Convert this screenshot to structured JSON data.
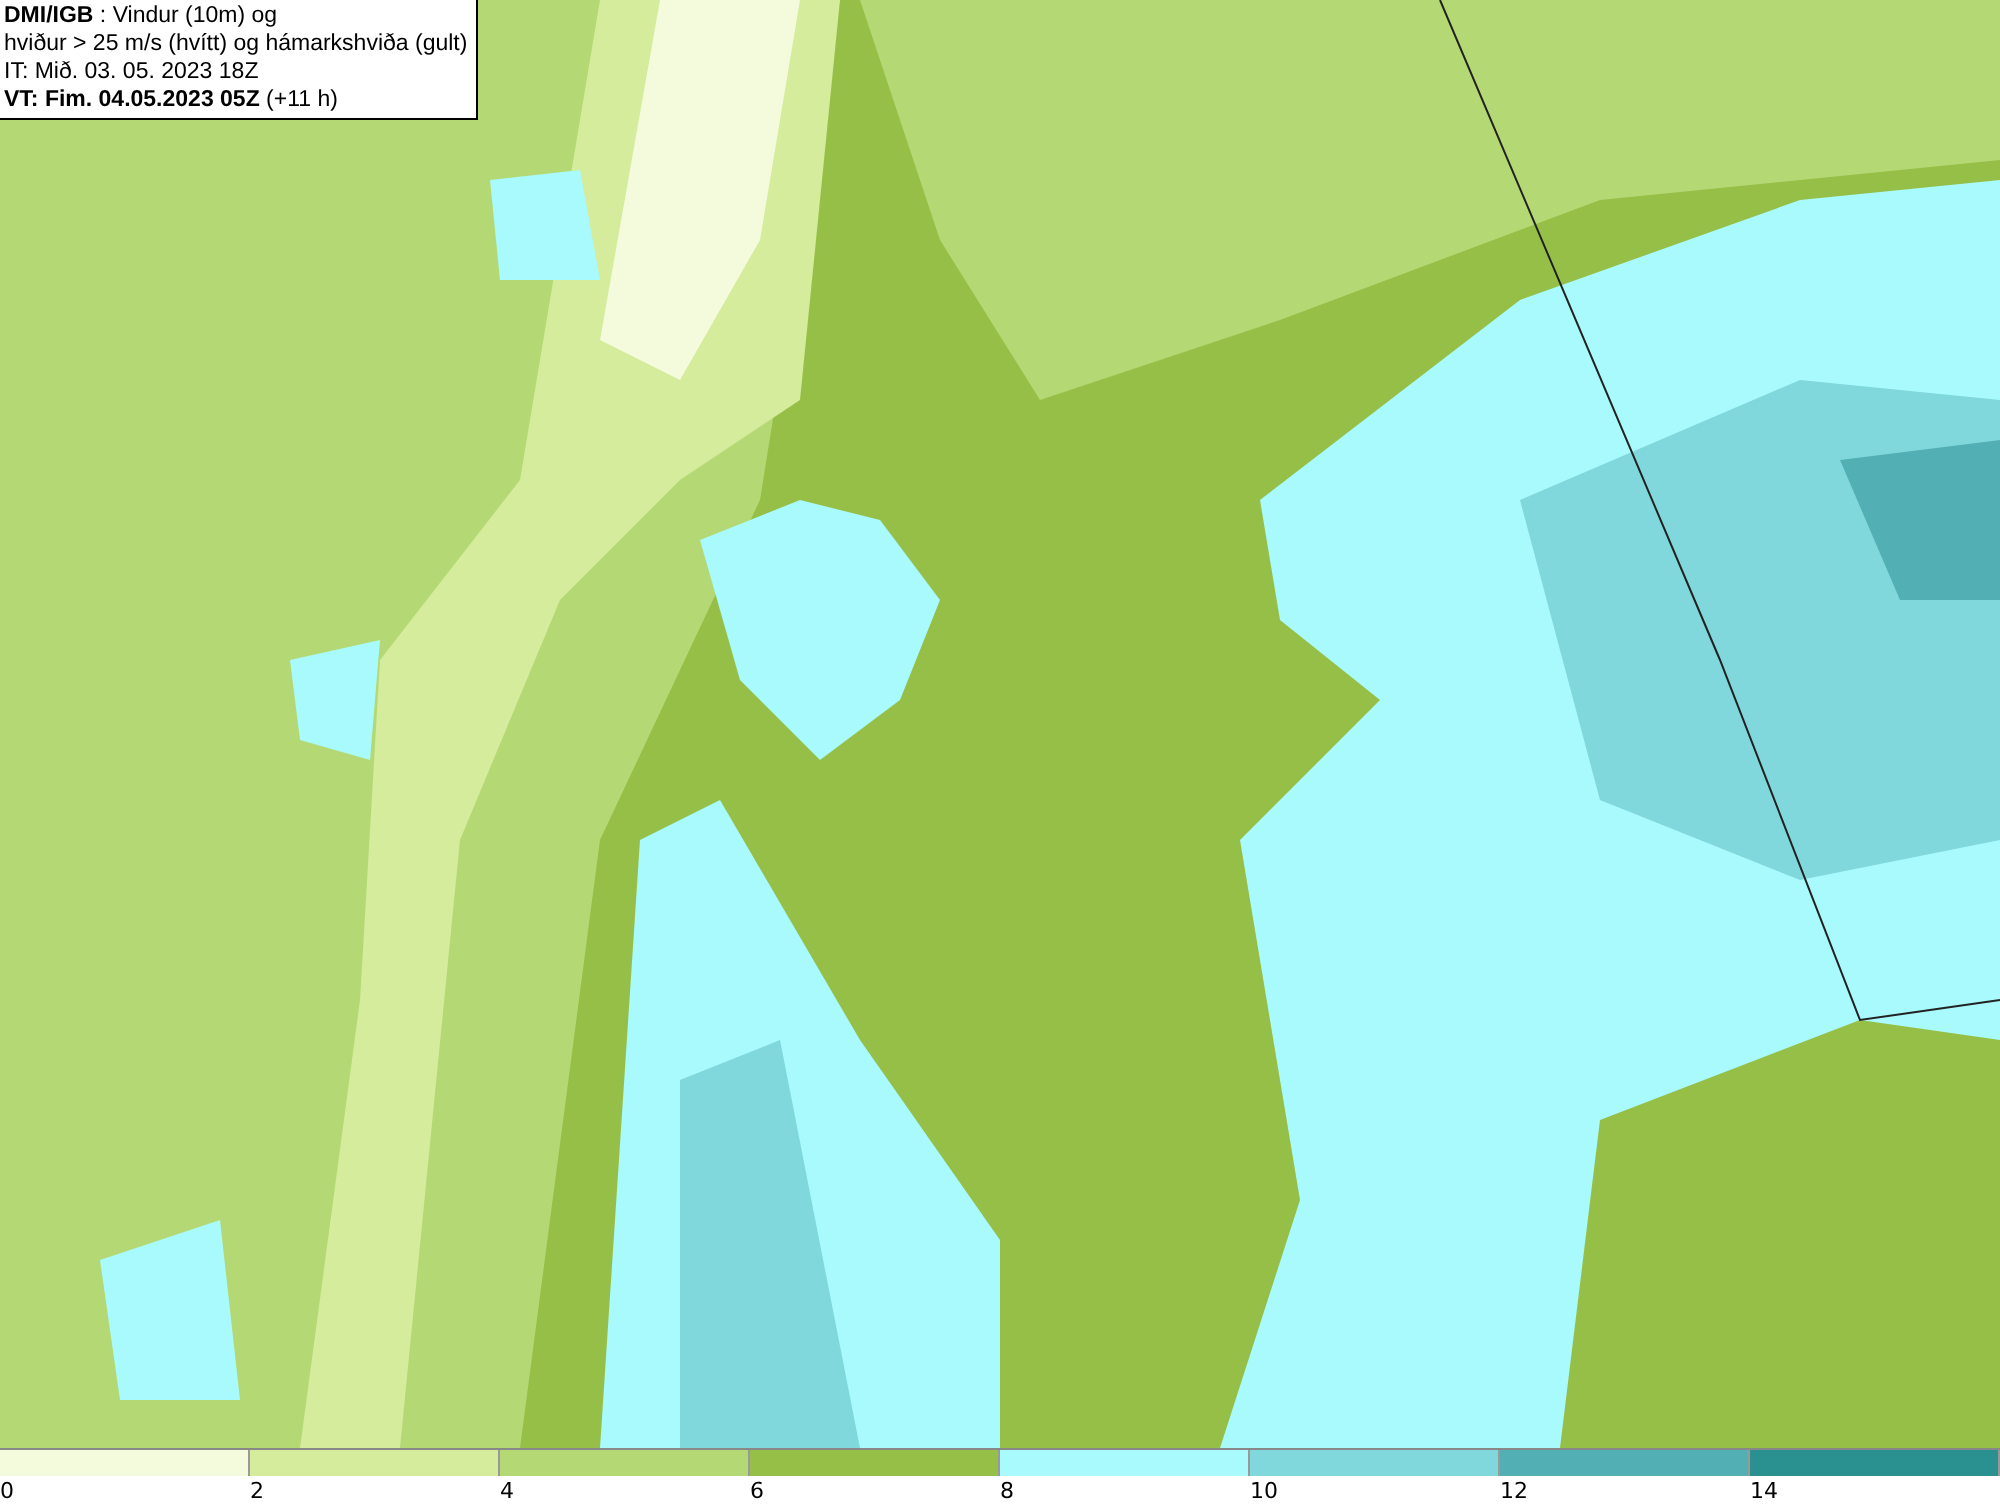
{
  "header": {
    "lines": [
      "**DMI/IGB** : Vindur (10m) og",
      "hviður > 25 m/s (hvítt) og hámarkshviða (gult)",
      "IT: Mið. 03. 05. 2023 18Z",
      "**VT: Fim. 04.05.2023 05Z** (+11 h)"
    ]
  },
  "legend": [
    {
      "label": "0",
      "color": "#f4fbdc"
    },
    {
      "label": "2",
      "color": "#d4ec9c"
    },
    {
      "label": "4",
      "color": "#b4d874"
    },
    {
      "label": "6",
      "color": "#96bf48"
    },
    {
      "label": "8",
      "color": "#a8fafc"
    },
    {
      "label": "10",
      "color": "#80d8dc"
    },
    {
      "label": "12",
      "color": "#52b0b4"
    },
    {
      "label": "14",
      "color": "#2a9090"
    }
  ]
}
